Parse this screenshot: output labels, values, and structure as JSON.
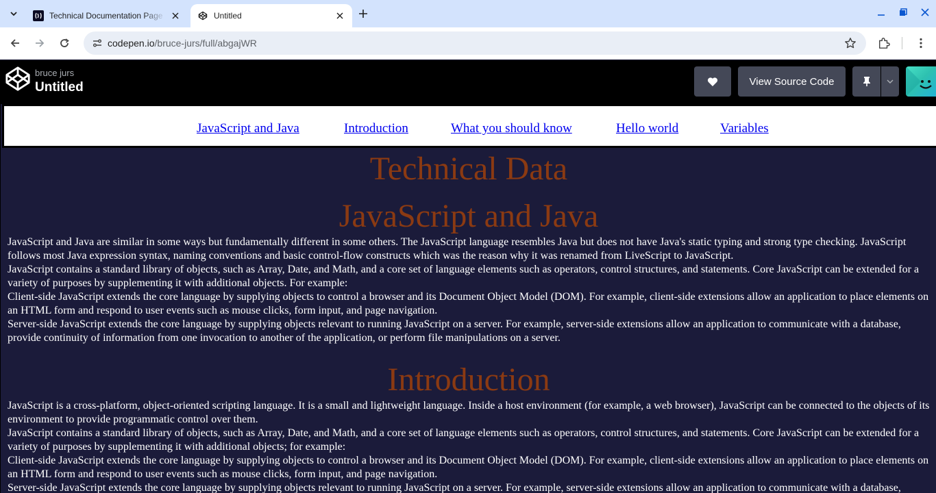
{
  "browser": {
    "tabs": [
      {
        "title": "Technical Documentation Page",
        "active": false
      },
      {
        "title": "Untitled",
        "active": true
      }
    ],
    "url_host": "codepen.io",
    "url_path": "/bruce-jurs/full/abgajWR"
  },
  "codepen": {
    "author": "bruce jurs",
    "title": "Untitled",
    "view_source_label": "View Source Code"
  },
  "nav": [
    "JavaScript and Java",
    "Introduction",
    "What you should know",
    "Hello world",
    "Variables"
  ],
  "page": {
    "main_title": "Technical Data",
    "sections": [
      {
        "heading": "JavaScript and Java",
        "paragraphs": [
          "JavaScript and Java are similar in some ways but fundamentally different in some others. The JavaScript language resembles Java but does not have Java's static typing and strong type checking. JavaScript follows most Java expression syntax, naming conventions and basic control-flow constructs which was the reason why it was renamed from LiveScript to JavaScript.",
          "JavaScript contains a standard library of objects, such as Array, Date, and Math, and a core set of language elements such as operators, control structures, and statements. Core JavaScript can be extended for a variety of purposes by supplementing it with additional objects. For example:",
          "Client-side JavaScript extends the core language by supplying objects to control a browser and its Document Object Model (DOM). For example, client-side extensions allow an application to place elements on an HTML form and respond to user events such as mouse clicks, form input, and page navigation.",
          "Server-side JavaScript extends the core language by supplying objects relevant to running JavaScript on a server. For example, server-side extensions allow an application to communicate with a database, provide continuity of information from one invocation to another of the application, or perform file manipulations on a server."
        ]
      },
      {
        "heading": "Introduction",
        "paragraphs": [
          "JavaScript is a cross-platform, object-oriented scripting language. It is a small and lightweight language. Inside a host environment (for example, a web browser), JavaScript can be connected to the objects of its environment to provide programmatic control over them.",
          "JavaScript contains a standard library of objects, such as Array, Date, and Math, and a core set of language elements such as operators, control structures, and statements. Core JavaScript can be extended for a variety of purposes by supplementing it with additional objects; for example:",
          "Client-side JavaScript extends the core language by supplying objects to control a browser and its Document Object Model (DOM). For example, client-side extensions allow an application to place elements on an HTML form and respond to user events such as mouse clicks, form input, and page navigation.",
          "Server-side JavaScript extends the core language by supplying objects relevant to running JavaScript on a server. For example, server-side extensions allow an application to communicate with a database, provide"
        ]
      }
    ]
  },
  "colors": {
    "heading": "#8b3a12",
    "page_bg": "#1b1b3a",
    "link": "#0000ee",
    "codepen_button": "#444857"
  },
  "icons": [
    "tab-search-icon",
    "codepen-favicon",
    "close-icon",
    "new-tab-icon",
    "minimize-icon",
    "maximize-icon",
    "window-close-icon",
    "back-icon",
    "forward-icon",
    "reload-icon",
    "site-info-icon",
    "star-icon",
    "extensions-icon",
    "kebab-menu-icon",
    "codepen-logo-icon",
    "heart-icon",
    "pin-icon",
    "chevron-down-icon"
  ]
}
